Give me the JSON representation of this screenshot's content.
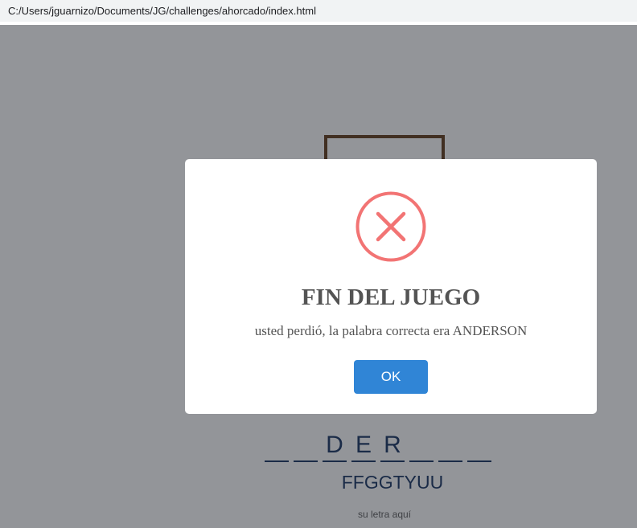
{
  "browser": {
    "address": "C:/Users/jguarnizo/Documents/JG/challenges/ahorcado/index.html"
  },
  "game": {
    "word_slots": [
      "",
      "",
      "D",
      "E",
      "R",
      "",
      "",
      ""
    ],
    "wrong_letters": "FFGGTYUU",
    "input_hint": "su letra aquí"
  },
  "modal": {
    "icon": "error-x-icon",
    "title": "FIN DEL JUEGO",
    "text": "usted perdió, la palabra correcta era ANDERSON",
    "ok_label": "OK"
  },
  "colors": {
    "overlay": "#919297",
    "icon": "#f27474",
    "button": "#3085d6",
    "word": "#0d2a5b",
    "gallows": "#5a3210"
  }
}
